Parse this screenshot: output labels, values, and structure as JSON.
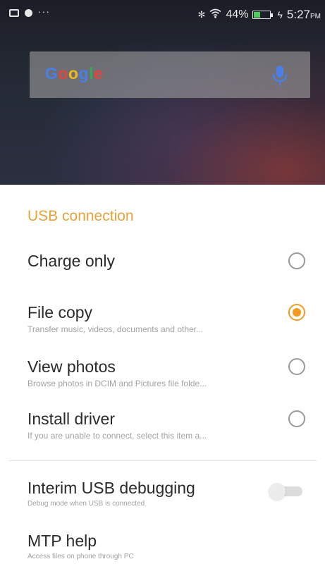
{
  "status_bar": {
    "left_icons": [
      "gallery-icon",
      "status-dot-icon",
      "more-icon"
    ],
    "more_glyph": "···",
    "bluetooth_glyph": "✻",
    "wifi_glyph": "◈",
    "battery_percent": "44%",
    "battery_level": 0.44,
    "charging_glyph": "ϟ",
    "time": "5:27",
    "time_suffix": "PM"
  },
  "search_widget": {
    "logo_letters": [
      {
        "char": "G",
        "color": "#4a7fe8"
      },
      {
        "char": "o",
        "color": "#e2463b"
      },
      {
        "char": "o",
        "color": "#f2b81c"
      },
      {
        "char": "g",
        "color": "#4a7fe8"
      },
      {
        "char": "l",
        "color": "#34a853"
      },
      {
        "char": "e",
        "color": "#e2463b"
      }
    ],
    "mic_color": "#4a7fe8"
  },
  "usb_dialog": {
    "title": "USB connection",
    "accent_color": "#f29a20",
    "options": [
      {
        "label": "Charge only",
        "description": "",
        "selected": false
      },
      {
        "label": "File copy",
        "description": "Transfer music, videos, documents and other...",
        "selected": true
      },
      {
        "label": "View photos",
        "description": "Browse photos in DCIM and Pictures file folde...",
        "selected": false
      },
      {
        "label": "Install driver",
        "description": "If you are unable to connect, select this item a...",
        "selected": false
      }
    ],
    "interim_debugging": {
      "label": "Interim USB debugging",
      "description": "Debug mode when USB is connected",
      "enabled": false
    },
    "mtp_help": {
      "label": "MTP help",
      "description": "Access files on phone through PC"
    }
  }
}
